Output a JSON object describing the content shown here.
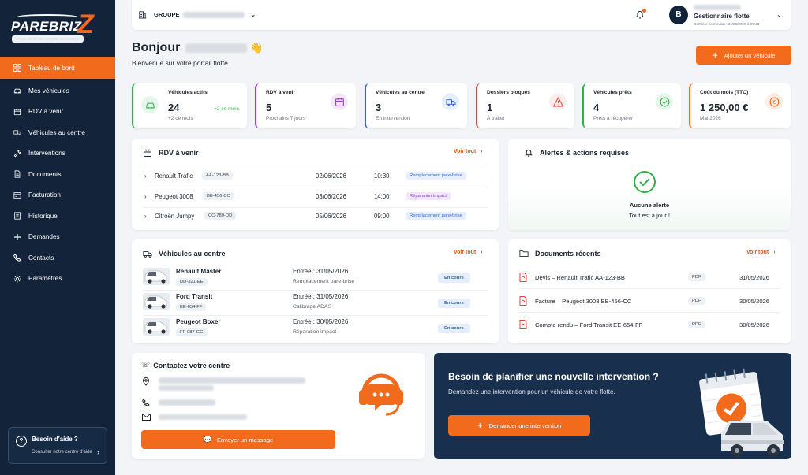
{
  "brand": {
    "name": "PAREBRIZ",
    "letter": "Z",
    "tagline": "LA CLARTÉ DE VOTRE SÉCURITÉ"
  },
  "sidebar": {
    "items": [
      {
        "label": "Tableau de bord",
        "icon": "grid-icon",
        "active": true
      },
      {
        "label": "Mes véhicules",
        "icon": "car-icon"
      },
      {
        "label": "RDV à venir",
        "icon": "calendar-icon"
      },
      {
        "label": "Véhicules au centre",
        "icon": "truck-icon"
      },
      {
        "label": "Interventions",
        "icon": "wrench-icon"
      },
      {
        "label": "Documents",
        "icon": "document-icon"
      },
      {
        "label": "Facturation",
        "icon": "invoice-icon"
      },
      {
        "label": "Historique",
        "icon": "history-icon"
      },
      {
        "label": "Demandes",
        "icon": "plus-icon"
      },
      {
        "label": "Contacts",
        "icon": "phone-icon"
      },
      {
        "label": "Paramètres",
        "icon": "gear-icon"
      }
    ],
    "help": {
      "title": "Besoin d'aide ?",
      "link": "Consulter notre centre d'aide"
    }
  },
  "topbar": {
    "group_label": "GROUPE",
    "avatar_letter": "B",
    "role": "Gestionnaire flotte",
    "last_login": "Dernière connexion : 31/05/2026 à 09:42"
  },
  "header": {
    "greeting": "Bonjour",
    "wave": "👋",
    "subtitle": "Bienvenue sur votre portail flotte",
    "add_button": "Ajouter un véhicule"
  },
  "kpis": [
    {
      "label": "Véhicules actifs",
      "value": "24",
      "sub": "+2 ce mois",
      "delta": "+2 ce mois",
      "color": "#2fb04a",
      "bg": "#e6f6ea",
      "icon": "car-icon"
    },
    {
      "label": "RDV à venir",
      "value": "5",
      "sub": "Prochains 7 jours",
      "color": "#9b3fd6",
      "bg": "#f3e8fb",
      "icon": "calendar-icon"
    },
    {
      "label": "Véhicules au centre",
      "value": "3",
      "sub": "En intervention",
      "color": "#2d63d8",
      "bg": "#e6eefc",
      "icon": "truck-icon"
    },
    {
      "label": "Dossiers bloqués",
      "value": "1",
      "sub": "À traiter",
      "color": "#e0463d",
      "bg": "#fdeceb",
      "icon": "warning-icon"
    },
    {
      "label": "Véhicules prêts",
      "value": "4",
      "sub": "Prêts à récupérer",
      "color": "#2fb04a",
      "bg": "#e6f6ea",
      "icon": "check-circle-icon"
    },
    {
      "label": "Coût du mois (TTC)",
      "value": "1 250,00 €",
      "sub": "Mai 2026",
      "color": "#f26a1b",
      "bg": "#fdeee4",
      "icon": "euro-icon"
    }
  ],
  "rdv": {
    "title": "RDV à venir",
    "see_all": "Voir tout",
    "rows": [
      {
        "vehicle": "Renault Trafic",
        "plate": "AA-123-BB",
        "date": "02/06/2026",
        "time": "10:30",
        "type": "Remplacement pare-brise",
        "type_color": "#2d63d8",
        "type_bg": "#e6eefc"
      },
      {
        "vehicle": "Peugeot 3008",
        "plate": "BB-456-CC",
        "date": "03/06/2026",
        "time": "14:00",
        "type": "Réparation impact",
        "type_color": "#8a3fc8",
        "type_bg": "#f1e6fa"
      },
      {
        "vehicle": "Citroën Jumpy",
        "plate": "CC-789-DD",
        "date": "05/06/2026",
        "time": "09:00",
        "type": "Remplacement pare-brise",
        "type_color": "#2d63d8",
        "type_bg": "#e6eefc"
      }
    ]
  },
  "alerts": {
    "title": "Alertes & actions requises",
    "none": "Aucune alerte",
    "ok": "Tout est à jour !"
  },
  "centre": {
    "title": "Véhicules au centre",
    "see_all": "Voir tout",
    "rows": [
      {
        "vehicle": "Renault Master",
        "plate": "DD-321-EE",
        "entry": "Entrée : 31/05/2026",
        "work": "Remplacement pare-brise",
        "status": "En cours"
      },
      {
        "vehicle": "Ford Transit",
        "plate": "EE-654-FF",
        "entry": "Entrée : 31/05/2026",
        "work": "Calibrage ADAS",
        "status": "En cours"
      },
      {
        "vehicle": "Peugeot Boxer",
        "plate": "FF-987-GG",
        "entry": "Entrée : 30/05/2026",
        "work": "Réparation impact",
        "status": "En cours"
      }
    ]
  },
  "docs": {
    "title": "Documents récents",
    "see_all": "Voir tout",
    "rows": [
      {
        "name": "Devis – Renault Trafic AA-123-BB",
        "type": "PDF",
        "date": "31/05/2026"
      },
      {
        "name": "Facture – Peugeot 3008 BB-456-CC",
        "type": "PDF",
        "date": "30/05/2026"
      },
      {
        "name": "Compte rendu – Ford Transit EE-654-FF",
        "type": "PDF",
        "date": "30/05/2026"
      }
    ]
  },
  "contact": {
    "title": "Contactez votre centre",
    "send": "Envoyer un message"
  },
  "cta": {
    "title": "Besoin de planifier une nouvelle intervention ?",
    "subtitle": "Demandez une intervention pour un véhicule de votre flotte.",
    "button": "Demander une intervention"
  }
}
